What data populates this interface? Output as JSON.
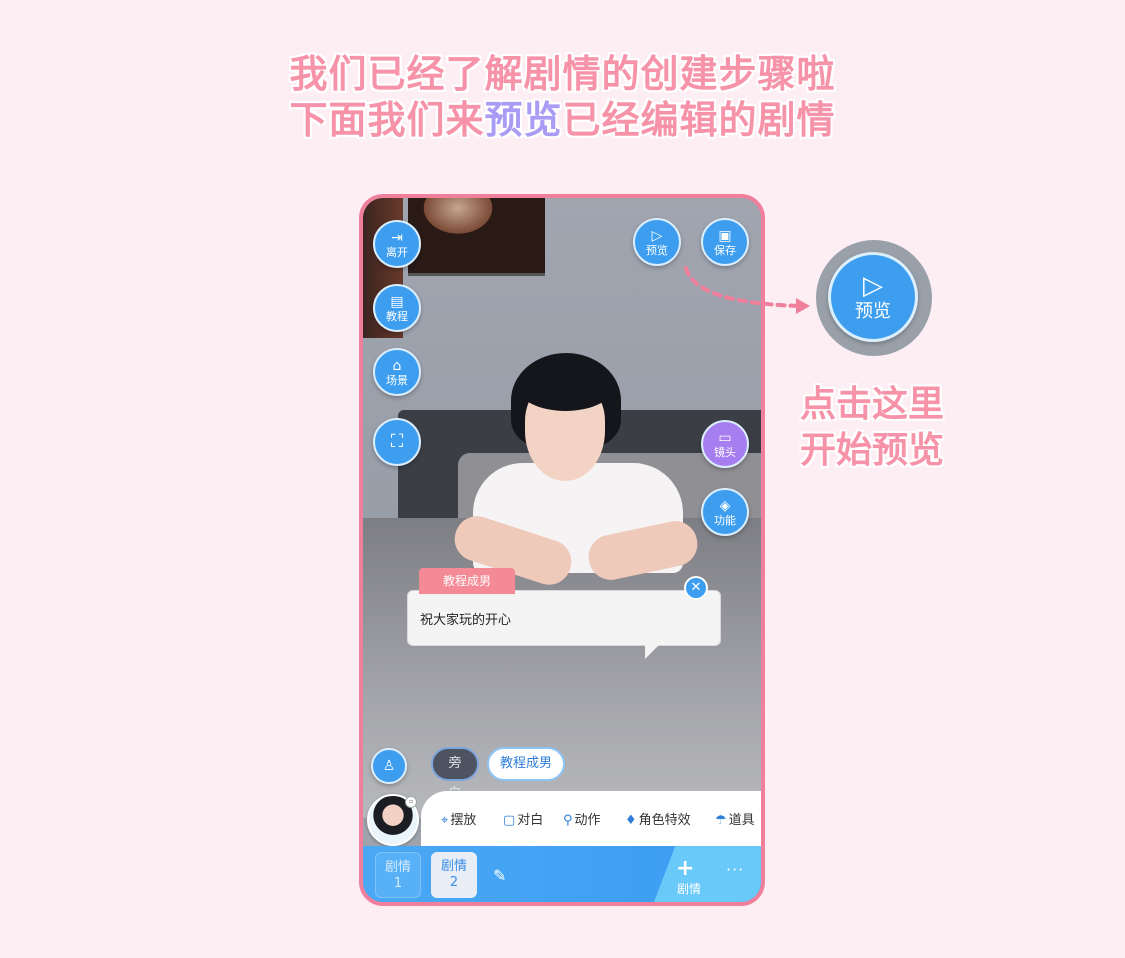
{
  "headline": {
    "line1": "我们已经了解剧情的创建步骤啦",
    "line2_before": "下面我们来",
    "line2_highlight": "预览",
    "line2_after": "已经编辑的剧情"
  },
  "left_buttons": {
    "leave": {
      "icon": "exit-icon",
      "label": "离开"
    },
    "tutorial": {
      "icon": "book-icon",
      "label": "教程"
    },
    "scene": {
      "icon": "scene-icon",
      "label": "场景"
    },
    "fullscreen": {
      "icon": "fullscreen-icon"
    }
  },
  "top_buttons": {
    "preview": {
      "icon": "play-icon",
      "label": "预览"
    },
    "save": {
      "icon": "save-icon",
      "label": "保存"
    }
  },
  "right_buttons": {
    "camera": {
      "icon": "camera-icon",
      "label": "镜头"
    },
    "function": {
      "icon": "cube-icon",
      "label": "功能"
    }
  },
  "dialog": {
    "speaker": "教程成男",
    "text": "祝大家玩的开心"
  },
  "role_chips": {
    "narration": "旁白",
    "character": "教程成男"
  },
  "toolbar": {
    "items": [
      {
        "icon": "pin-icon",
        "label": "摆放"
      },
      {
        "icon": "chat-icon",
        "label": "对白"
      },
      {
        "icon": "pose-icon",
        "label": "动作"
      },
      {
        "icon": "effect-icon",
        "label": "角色特效"
      },
      {
        "icon": "umbrella-icon",
        "label": "道具"
      }
    ]
  },
  "plots": {
    "tab1": {
      "line1": "剧情",
      "line2": "1"
    },
    "tab2": {
      "line1": "剧情",
      "line2": "2"
    },
    "add_label": "剧情"
  },
  "callout": {
    "preview_label": "预览",
    "line1": "点击这里",
    "line2": "开始预览"
  },
  "colors": {
    "background": "#fdeef4",
    "headline": "#f693a8",
    "highlight": "#a99cf4",
    "button_blue": "#3d9ef0",
    "button_purple": "#a77ef0",
    "frame": "#f07f9c"
  }
}
